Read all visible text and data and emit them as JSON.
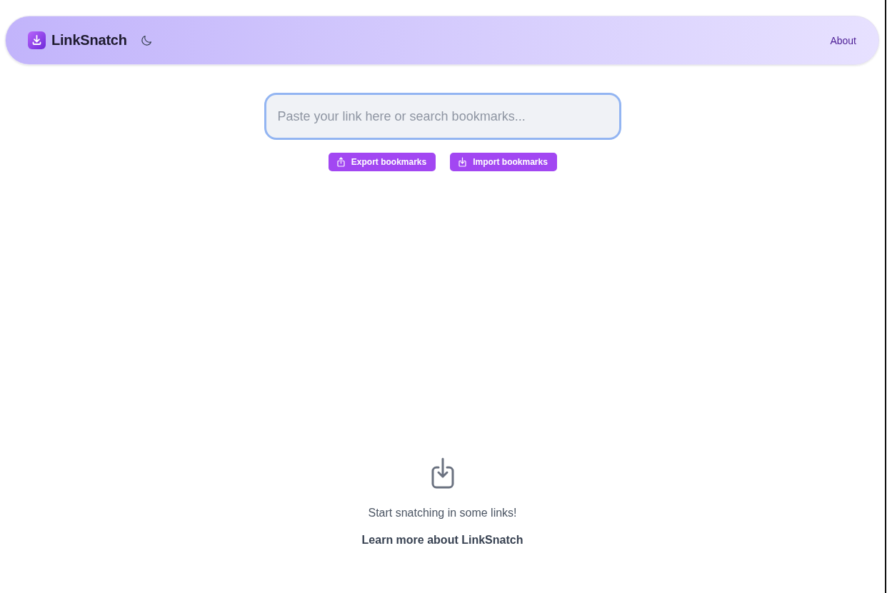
{
  "header": {
    "brand": "LinkSnatch",
    "nav": [
      {
        "label": "About"
      }
    ]
  },
  "search": {
    "placeholder": "Paste your link here or search bookmarks...",
    "focused": true
  },
  "actions": [
    {
      "label": "Export bookmarks",
      "kind": "export"
    },
    {
      "label": "Import bookmarks",
      "kind": "import"
    }
  ],
  "empty_state": {
    "message": "Start snatching in some links!",
    "link": "Learn more about LinkSnatch"
  }
}
